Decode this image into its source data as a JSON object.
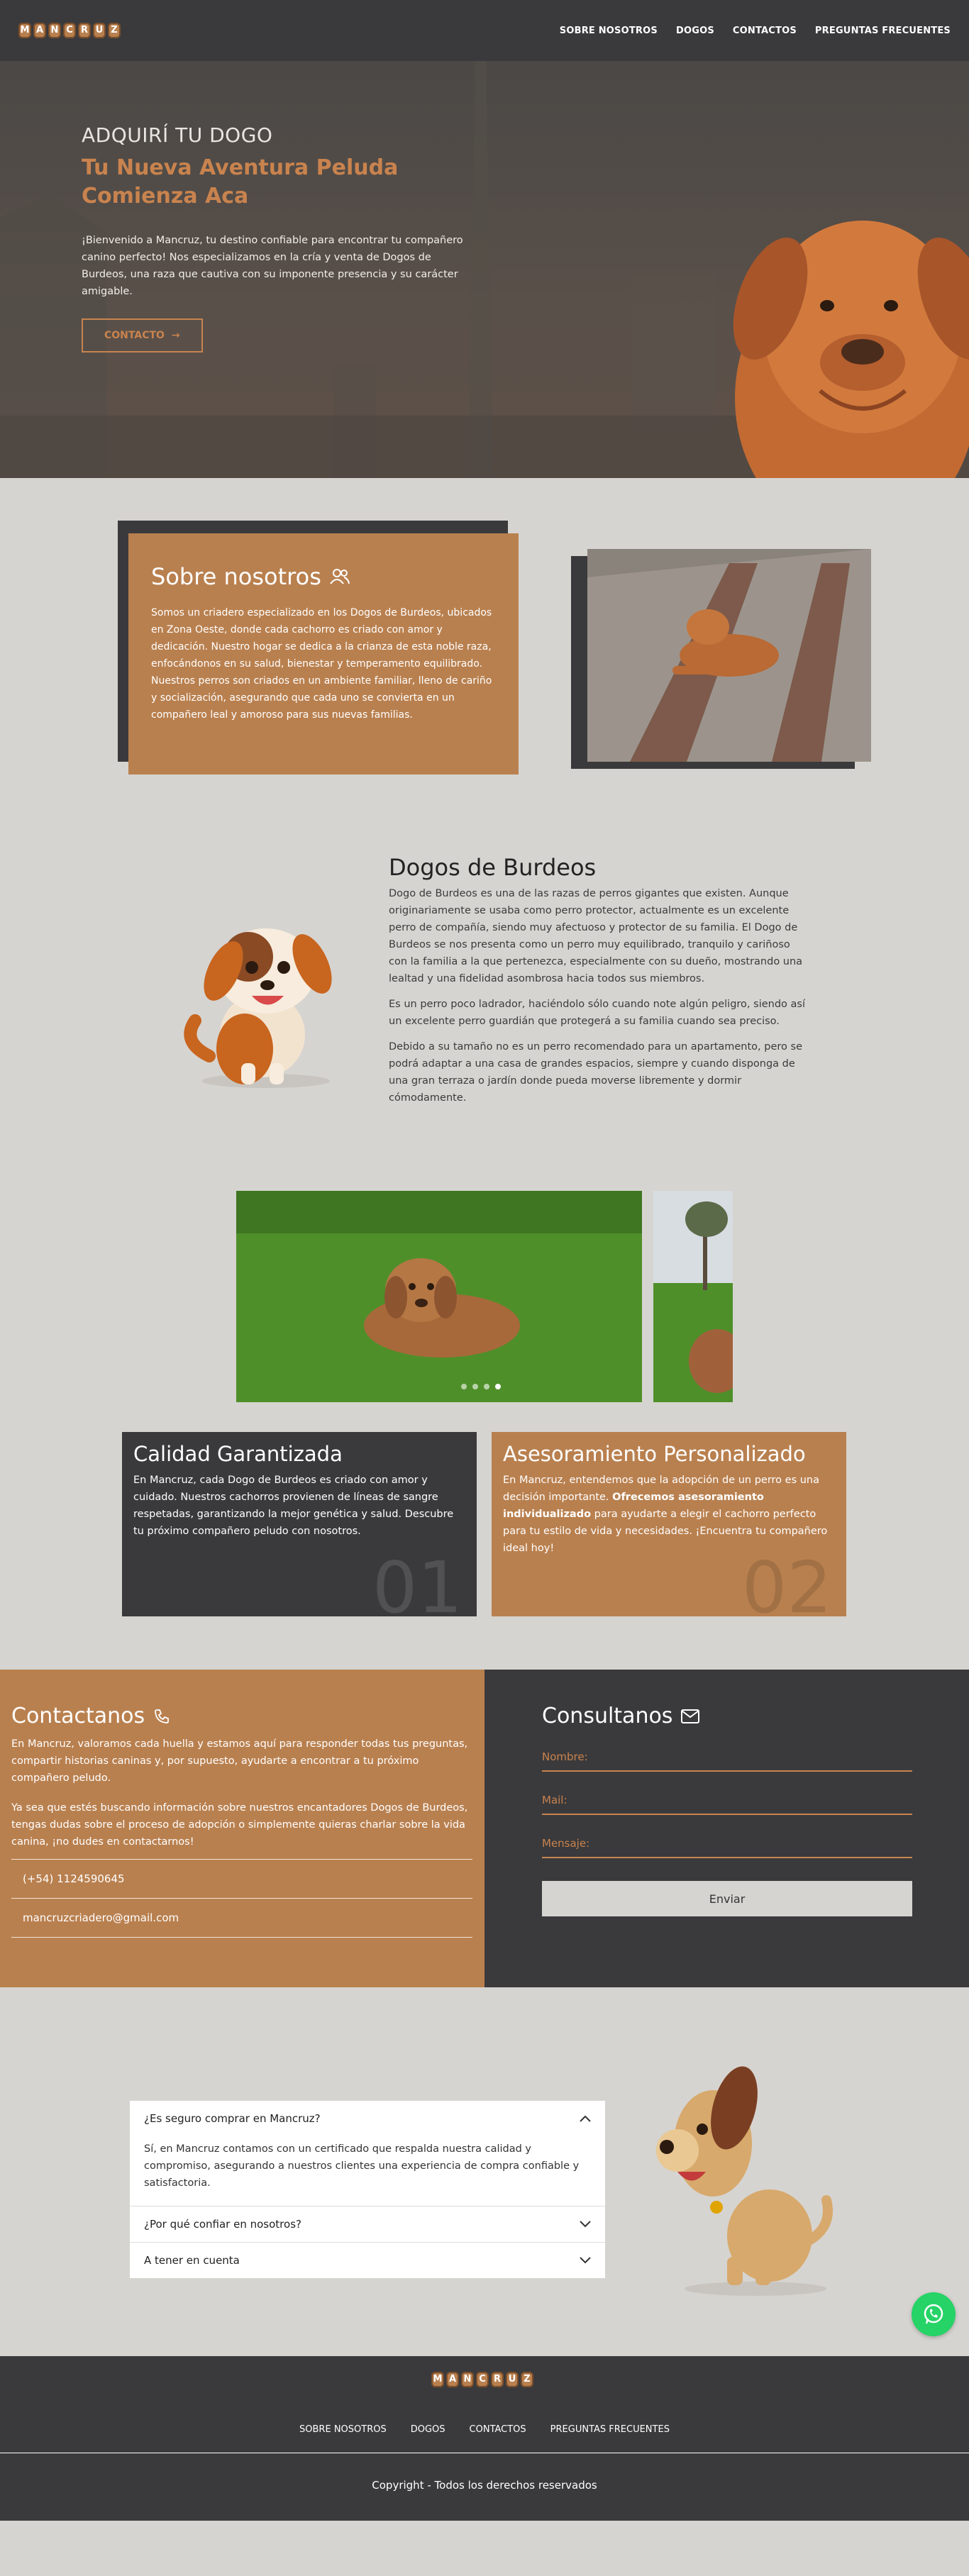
{
  "brand": {
    "logo_text": "MANCRUZ",
    "letters": [
      "M",
      "A",
      "N",
      "C",
      "R",
      "U",
      "Z"
    ]
  },
  "nav": {
    "items": [
      {
        "label": "SOBRE NOSOTROS"
      },
      {
        "label": "DOGOS"
      },
      {
        "label": "CONTACTOS"
      },
      {
        "label": "PREGUNTAS FRECUENTES"
      }
    ]
  },
  "hero": {
    "kicker": "ADQUIRÍ TU DOGO",
    "title": "Tu Nueva Aventura Peluda Comienza Aca",
    "text": "¡Bienvenido a Mancruz, tu destino confiable para encontrar tu compañero canino perfecto! Nos especializamos en la cría y venta de Dogos de Burdeos, una raza que cautiva con su imponente presencia y su carácter amigable.",
    "button_label": "CONTACTO"
  },
  "about": {
    "title": "Sobre nosotros",
    "text": "Somos un criadero especializado en los Dogos de Burdeos, ubicados en Zona Oeste, donde cada cachorro es criado con amor y dedicación. Nuestro hogar se dedica a la crianza de esta noble raza, enfocándonos en su salud, bienestar y temperamento equilibrado. Nuestros perros son criados en un ambiente familiar, lleno de cariño y socialización, asegurando que cada uno se convierta en un compañero leal y amoroso para sus nuevas familias."
  },
  "breed": {
    "title": "Dogos de Burdeos",
    "paragraphs": [
      "Dogo de Burdeos es una de las razas de perros gigantes que existen. Aunque originariamente se usaba como perro protector, actualmente es un excelente perro de compañía, siendo muy afectuoso y protector de su familia. El Dogo de Burdeos se nos presenta como un perro muy equilibrado, tranquilo y cariñoso con la familia a la que pertenezca, especialmente con su dueño, mostrando una lealtad y una fidelidad asombrosa hacia todos sus miembros.",
      "Es un perro poco ladrador, haciéndolo sólo cuando note algún peligro, siendo así un excelente perro guardián que protegerá a su familia cuando sea preciso.",
      "Debido a su tamaño no es un perro recomendado para un apartamento, pero se podrá adaptar a una casa de grandes espacios, siempre y cuando disponga de una gran terraza o jardín donde pueda moverse libremente y dormir cómodamente."
    ]
  },
  "carousel": {
    "dots": 4,
    "active_index": 3
  },
  "features": [
    {
      "title": "Calidad Garantizada",
      "text": "En Mancruz, cada Dogo de Burdeos es criado con amor y cuidado. Nuestros cachorros provienen de líneas de sangre respetadas, garantizando la mejor genética y salud. Descubre tu próximo compañero peludo con nosotros.",
      "number": "01"
    },
    {
      "title": "Asesoramiento Personalizado",
      "text_before": "En Mancruz, entendemos que la adopción de un perro es una decisión importante. ",
      "text_bold": "Ofrecemos asesoramiento individualizado",
      "text_after": " para ayudarte a elegir el cachorro perfecto para tu estilo de vida y necesidades. ¡Encuentra tu compañero ideal hoy!",
      "number": "02"
    }
  ],
  "contact": {
    "title": "Contactanos",
    "paragraphs": [
      "En Mancruz, valoramos cada huella y estamos aquí para responder todas tus preguntas, compartir historias caninas y, por supuesto, ayudarte a encontrar a tu próximo compañero peludo.",
      "Ya sea que estés buscando información sobre nuestros encantadores Dogos de Burdeos, tengas dudas sobre el proceso de adopción o simplemente quieras charlar sobre la vida canina, ¡no dudes en contactarnos!"
    ],
    "phone": "(+54) 1124590645",
    "email": "mancruzcriadero@gmail.com"
  },
  "form": {
    "title": "Consultanos",
    "name_label": "Nombre:",
    "mail_label": "Mail:",
    "message_label": "Mensaje:",
    "send_label": "Enviar"
  },
  "faq": {
    "items": [
      {
        "question": "¿Es seguro comprar en Mancruz?",
        "answer": "Sí, en Mancruz contamos con un certificado que respalda nuestra calidad y compromiso, asegurando a nuestros clientes una experiencia de compra confiable y satisfactoria."
      },
      {
        "question": "¿Por qué confiar en nosotros?"
      },
      {
        "question": "A tener en cuenta"
      }
    ]
  },
  "footer": {
    "links": [
      "SOBRE NOSOTROS",
      "DOGOS",
      "CONTACTOS",
      "PREGUNTAS FRECUENTES"
    ],
    "copyright": "Copyright - Todos los derechos reservados"
  },
  "colors": {
    "accent": "#b9804f",
    "dark": "#3a3a3c",
    "background": "#d6d4d0",
    "whatsapp": "#25d366"
  },
  "icons": {
    "hero_button": "arrow-right-icon",
    "about": "users-icon",
    "contact": "phone-icon",
    "form": "mail-icon",
    "faq": "chevron-down-icon",
    "floating": "whatsapp-icon"
  }
}
